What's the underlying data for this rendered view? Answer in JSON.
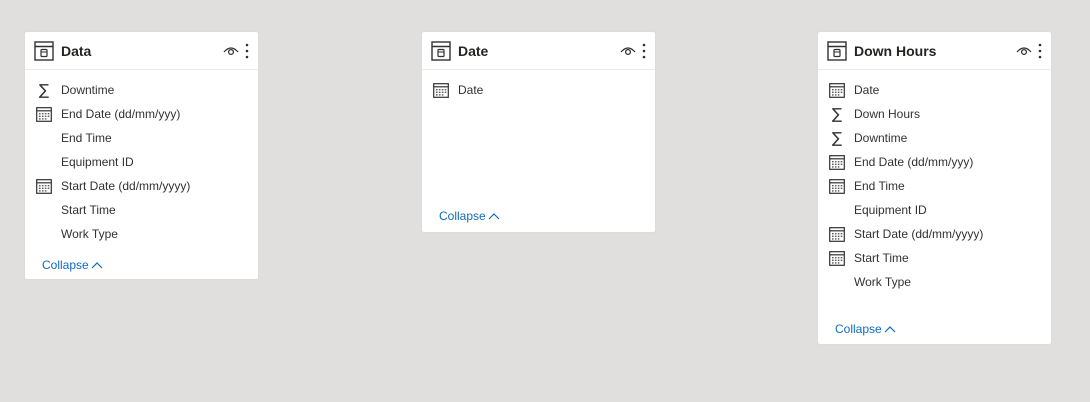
{
  "colors": {
    "canvas": "#e1dfdd",
    "card": "#ffffff",
    "text": "#252423",
    "link": "#0f6cbd"
  },
  "tables": [
    {
      "title": "Data",
      "collapse_label": "Collapse",
      "fields": [
        {
          "label": "Downtime",
          "icon": "sigma-icon"
        },
        {
          "label": "End Date (dd/mm/yyy)",
          "icon": "calendar-icon"
        },
        {
          "label": "End Time",
          "icon": ""
        },
        {
          "label": "Equipment ID",
          "icon": ""
        },
        {
          "label": "Start Date (dd/mm/yyyy)",
          "icon": "calendar-icon"
        },
        {
          "label": "Start Time",
          "icon": ""
        },
        {
          "label": "Work Type",
          "icon": ""
        }
      ]
    },
    {
      "title": "Date",
      "collapse_label": "Collapse",
      "fields": [
        {
          "label": "Date",
          "icon": "calendar-icon"
        }
      ]
    },
    {
      "title": "Down Hours",
      "collapse_label": "Collapse",
      "fields": [
        {
          "label": "Date",
          "icon": "calendar-icon"
        },
        {
          "label": "Down Hours",
          "icon": "sigma-icon"
        },
        {
          "label": "Downtime",
          "icon": "sigma-icon"
        },
        {
          "label": "End Date (dd/mm/yyy)",
          "icon": "calendar-icon"
        },
        {
          "label": "End Time",
          "icon": "calendar-icon"
        },
        {
          "label": "Equipment ID",
          "icon": ""
        },
        {
          "label": "Start Date (dd/mm/yyyy)",
          "icon": "calendar-icon"
        },
        {
          "label": "Start Time",
          "icon": "calendar-icon"
        },
        {
          "label": "Work Type",
          "icon": ""
        }
      ]
    }
  ]
}
